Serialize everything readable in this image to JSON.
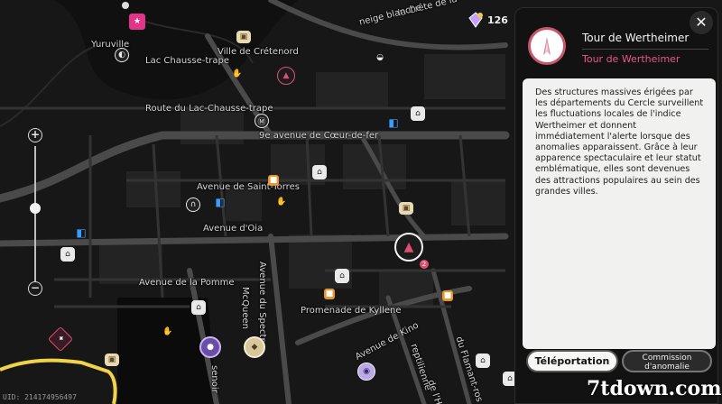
{
  "map": {
    "labels": {
      "crete": "la Crête de la",
      "neige": "neige blanche",
      "yuruville": "Yuruville",
      "ville_cretenord": "Ville de Crétenord",
      "lac_chausse": "Lac Chausse-trape",
      "route_lac": "Route du Lac-Chausse-trape",
      "ave_coeur": "9e avenue de Cœur-de-fer",
      "ave_saint_torres": "Avenue de Saint-Torres",
      "ave_oia": "Avenue d'Oia",
      "ave_pomme": "Avenue de la Pomme",
      "mcqueen": "McQueen",
      "ave_spectr": "Avenue du Spectr",
      "promenade": "Promenade de Kyllene",
      "ave_kino": "Avenue de Kino",
      "reptilienne": "reptilienne",
      "flamant": "du Flamant-ros",
      "senoir": "senoir",
      "rue_h": "de l'Hé"
    },
    "uid": "UID: 214174956497"
  },
  "zoom": {
    "plus": "+",
    "minus": "−",
    "level": 0.55
  },
  "currency": {
    "amount": "126",
    "icon": "gem-icon"
  },
  "panel": {
    "title": "Tour de Wertheimer",
    "subtitle": "Tour de Wertheimer",
    "close": "✕",
    "description": "Des structures massives érigées par les départements du Cercle surveillent les fluctuations locales de l'indice Wertheimer et donnent immédiatement l'alerte lorsque des anomalies apparaissent. Grâce à leur apparence spectaculaire et leur statut emblématique, elles sont devenues des attractions populaires au sein des grandes villes.",
    "teleport": "Téléportation",
    "commission": "Commission d'anomalie",
    "accent": "#e8578a"
  },
  "watermark": "7tdown.com"
}
